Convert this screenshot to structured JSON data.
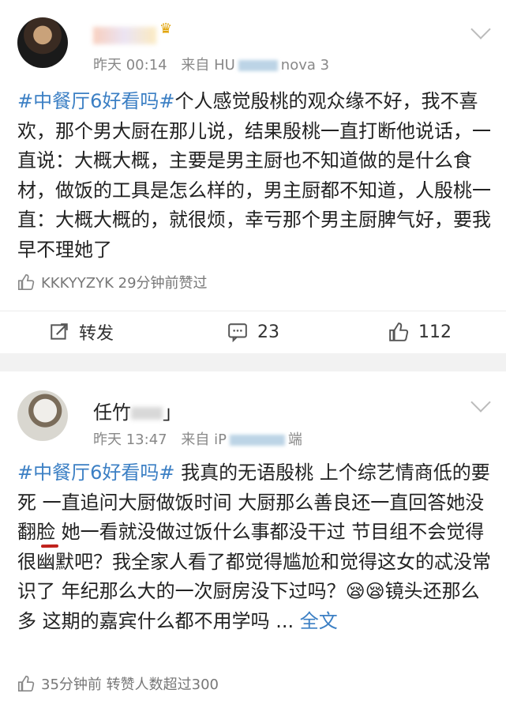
{
  "post1": {
    "username": "",
    "time_label": "昨天 00:14",
    "source_prefix": "来自 HU",
    "source_suffix": "nova 3",
    "text_tag": "#中餐厅6好看吗#",
    "text_rest": "个人感觉殷桃的观众缘不好，我不喜欢，那个男大厨在那儿说，结果殷桃一直打断他说话，一直说：大概大概，主要是男主厨也不知道做的是什么食材，做饭的工具是怎么样的，男主厨都不知道，人殷桃一直：大概大概的，就很烦，幸亏那个男主厨脾气好，要我早不理她了",
    "like_text": "KKKYYZYK 29分钟前赞过",
    "repost_label": "转发",
    "comment_count": "23",
    "like_count": "112"
  },
  "post2": {
    "username": "任竹",
    "username_suffix": "」",
    "time_label": "昨天 13:47",
    "source_prefix": "来自 iP",
    "source_suffix": "端",
    "tag": "#中餐厅6好看吗#",
    "seg1": " 我真的无语殷桃 上个综艺情商低的要死 ",
    "seg2": "一直追问大厨做饭时间 大厨那么善良还一直回答她没翻脸",
    "seg3": " 她一看就没做过饭什么事都没干过 节目组不会觉得很幽默吧？我全家人看了都觉得尴尬和觉得这女的忒没常识了 年纪那么大的一次厨房没下过吗？😪😪镜头还那么多 这期的嘉宾什么都不用学吗 ... ",
    "full_link": "全文",
    "bottom_text": "35分钟前 转赞人数超过300"
  },
  "colors": {
    "link": "#3b7fc4",
    "underline": "#c0211c",
    "separator": "#f2f2f2"
  }
}
